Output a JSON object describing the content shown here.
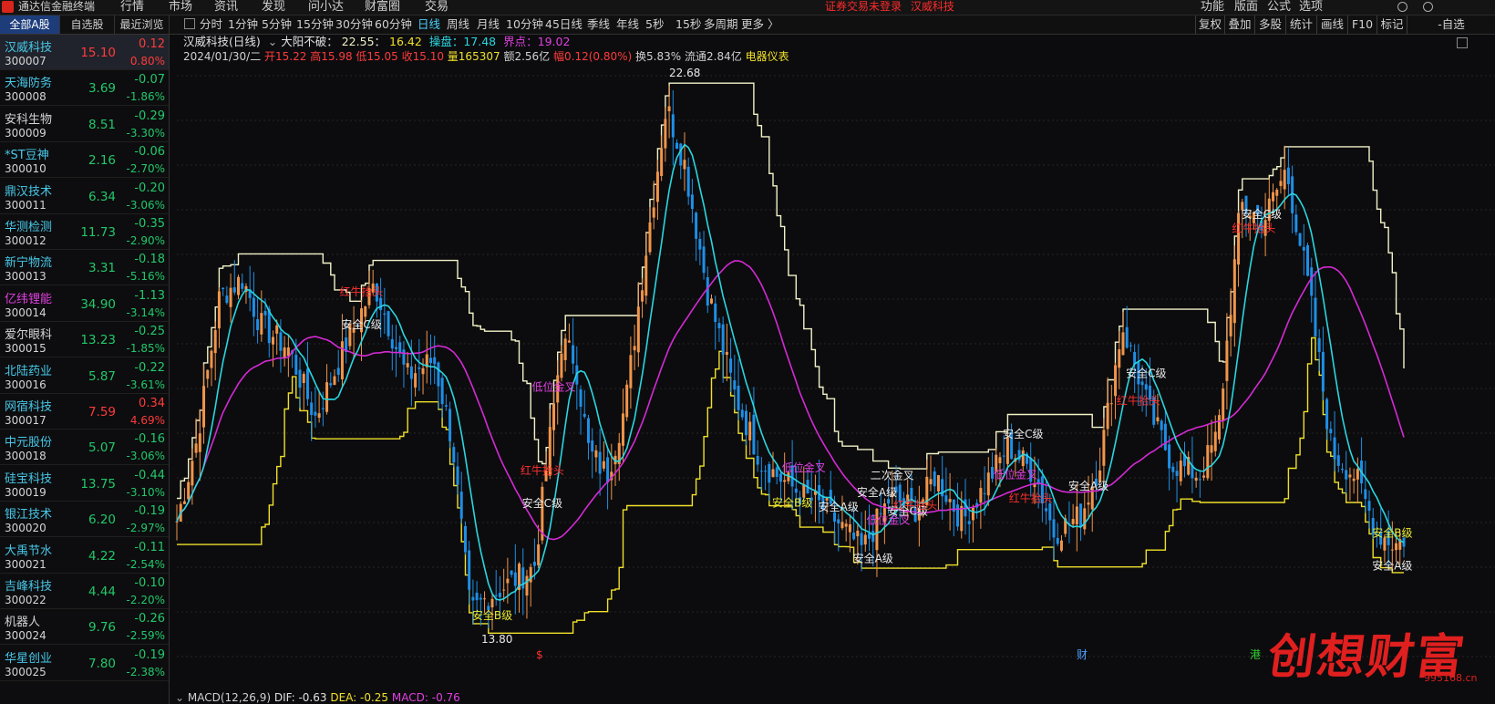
{
  "app": {
    "name": "通达信金融终端",
    "notice": "证券交易未登录",
    "current_stock": "汉威科技"
  },
  "menu": [
    "行情",
    "市场",
    "资讯",
    "发现",
    "问小达",
    "财富圈",
    "交易"
  ],
  "right_menu": [
    "功能",
    "版面",
    "公式",
    "选项"
  ],
  "list_tabs": [
    "全部A股",
    "自选股",
    "最近浏览"
  ],
  "periods": [
    "分时",
    "1分钟",
    "5分钟",
    "15分钟",
    "30分钟",
    "60分钟",
    "日线",
    "周线",
    "月线",
    "10分钟",
    "45日线",
    "季线",
    "年线",
    "5秒",
    "15秒",
    "多周期",
    "更多 〉"
  ],
  "active_period": "日线",
  "right_tools": [
    "复权",
    "叠加",
    "多股",
    "统计",
    "画线",
    "F10",
    "标记",
    "-自选"
  ],
  "stocks": [
    {
      "name": "汉威科技",
      "code": "300007",
      "price": "15.10",
      "change": "0.12",
      "pct": "0.80%",
      "dir": "up",
      "name_color": "#48c8e8"
    },
    {
      "name": "天海防务",
      "code": "300008",
      "price": "3.69",
      "change": "-0.07",
      "pct": "-1.86%",
      "dir": "dn",
      "name_color": "#48c8e8"
    },
    {
      "name": "安科生物",
      "code": "300009",
      "price": "8.51",
      "change": "-0.29",
      "pct": "-3.30%",
      "dir": "dn",
      "name_color": "#d4d4d4"
    },
    {
      "name": "*ST豆神",
      "code": "300010",
      "price": "2.16",
      "change": "-0.06",
      "pct": "-2.70%",
      "dir": "dn",
      "name_color": "#48c8e8"
    },
    {
      "name": "鼎汉技术",
      "code": "300011",
      "price": "6.34",
      "change": "-0.20",
      "pct": "-3.06%",
      "dir": "dn",
      "name_color": "#48c8e8"
    },
    {
      "name": "华测检测",
      "code": "300012",
      "price": "11.73",
      "change": "-0.35",
      "pct": "-2.90%",
      "dir": "dn",
      "name_color": "#48c8e8"
    },
    {
      "name": "新宁物流",
      "code": "300013",
      "price": "3.31",
      "change": "-0.18",
      "pct": "-5.16%",
      "dir": "dn",
      "name_color": "#48c8e8"
    },
    {
      "name": "亿纬锂能",
      "code": "300014",
      "price": "34.90",
      "change": "-1.13",
      "pct": "-3.14%",
      "dir": "dn",
      "name_color": "#e040e0"
    },
    {
      "name": "爱尔眼科",
      "code": "300015",
      "price": "13.23",
      "change": "-0.25",
      "pct": "-1.85%",
      "dir": "dn",
      "name_color": "#d4d4d4"
    },
    {
      "name": "北陆药业",
      "code": "300016",
      "price": "5.87",
      "change": "-0.22",
      "pct": "-3.61%",
      "dir": "dn",
      "name_color": "#48c8e8"
    },
    {
      "name": "网宿科技",
      "code": "300017",
      "price": "7.59",
      "change": "0.34",
      "pct": "4.69%",
      "dir": "up",
      "name_color": "#48c8e8"
    },
    {
      "name": "中元股份",
      "code": "300018",
      "price": "5.07",
      "change": "-0.16",
      "pct": "-3.06%",
      "dir": "dn",
      "name_color": "#48c8e8"
    },
    {
      "name": "硅宝科技",
      "code": "300019",
      "price": "13.75",
      "change": "-0.44",
      "pct": "-3.10%",
      "dir": "dn",
      "name_color": "#48c8e8"
    },
    {
      "name": "银江技术",
      "code": "300020",
      "price": "6.20",
      "change": "-0.19",
      "pct": "-2.97%",
      "dir": "dn",
      "name_color": "#48c8e8"
    },
    {
      "name": "大禹节水",
      "code": "300021",
      "price": "4.22",
      "change": "-0.11",
      "pct": "-2.54%",
      "dir": "dn",
      "name_color": "#48c8e8"
    },
    {
      "name": "吉峰科技",
      "code": "300022",
      "price": "4.44",
      "change": "-0.10",
      "pct": "-2.20%",
      "dir": "dn",
      "name_color": "#48c8e8"
    },
    {
      "name": "机器人",
      "code": "300024",
      "price": "9.76",
      "change": "-0.26",
      "pct": "-2.59%",
      "dir": "dn",
      "name_color": "#d4d4d4"
    },
    {
      "name": "华星创业",
      "code": "300025",
      "price": "7.80",
      "change": "-0.19",
      "pct": "-2.38%",
      "dir": "dn",
      "name_color": "#48c8e8"
    }
  ],
  "header": {
    "title": "汉威科技(日线)",
    "ind_name": "大阳不破",
    "ind_v1": "22.55",
    "ind_v2": "16.42",
    "pan_label": "操盘",
    "pan_val": "17.48",
    "jie_label": "界点",
    "jie_val": "19.02",
    "date": "2024/01/30/二",
    "open": "开15.22",
    "high": "高15.98",
    "low": "低15.05",
    "close": "收15.10",
    "vol": "量165307",
    "amt": "额2.56亿",
    "range": "幅0.12(0.80%)",
    "turnover": "换5.83%",
    "float": "流通2.84亿",
    "sector": "电器仪表"
  },
  "macd": {
    "label": "MACD(12,26,9)",
    "dif": "DIF: -0.63",
    "dea": "DEA: -0.25",
    "macd": "MACD: -0.76"
  },
  "watermark": {
    "text": "创想财富",
    "site": "995168.cn"
  },
  "colors": {
    "up": "#ff3b3b",
    "down": "#22c86a",
    "candle_up": "#f0954a",
    "candle_down": "#1e8fe6",
    "ma_fast": "#2ad6e0",
    "ma_slow": "#d42ad4",
    "upper": "#f2f2c8",
    "lower": "#f0e02a"
  },
  "chart_data": {
    "type": "candlestick",
    "peak_label": "22.68",
    "low_label": "13.80",
    "annotations": [
      {
        "text": "红牛抬头",
        "color": "#ff3030",
        "idx": 48
      },
      {
        "text": "安全C级",
        "color": "#e8e8e8",
        "idx": 48
      },
      {
        "text": "红牛抬头",
        "color": "#ff3030",
        "idx": 95
      },
      {
        "text": "安全C级",
        "color": "#e8e8e8",
        "idx": 95
      },
      {
        "text": "低位金叉",
        "color": "#e040e0",
        "idx": 98
      },
      {
        "text": "安全B级",
        "color": "#e8e830",
        "idx": 82
      },
      {
        "text": "低位金叉",
        "color": "#e040e0",
        "idx": 163
      },
      {
        "text": "安全B级",
        "color": "#e8e830",
        "idx": 160
      },
      {
        "text": "安全A级",
        "color": "#e8e8e8",
        "idx": 172
      },
      {
        "text": "安全A级",
        "color": "#e8e8e8",
        "idx": 181
      },
      {
        "text": "安全A级",
        "color": "#e8e8e8",
        "idx": 182
      },
      {
        "text": "低位金叉",
        "color": "#e040e0",
        "idx": 185
      },
      {
        "text": "二次金叉",
        "color": "#e8e8e8",
        "idx": 186
      },
      {
        "text": "安全C级",
        "color": "#e8e8e8",
        "idx": 190
      },
      {
        "text": "红牛抬头",
        "color": "#ff3030",
        "idx": 192
      },
      {
        "text": "低位金叉",
        "color": "#e040e0",
        "idx": 218
      },
      {
        "text": "安全C级",
        "color": "#e8e8e8",
        "idx": 220
      },
      {
        "text": "红牛抬头",
        "color": "#ff3030",
        "idx": 222
      },
      {
        "text": "安全A级",
        "color": "#e8e8e8",
        "idx": 237
      },
      {
        "text": "红牛抬头",
        "color": "#ff3030",
        "idx": 250
      },
      {
        "text": "安全C级",
        "color": "#e8e8e8",
        "idx": 252
      },
      {
        "text": "红牛抬头",
        "color": "#ff3030",
        "idx": 280
      },
      {
        "text": "安全C级",
        "color": "#e8e8e8",
        "idx": 282
      },
      {
        "text": "安全A级",
        "color": "#e8e8e8",
        "idx": 316
      },
      {
        "text": "安全B级",
        "color": "#e8e830",
        "idx": 316
      }
    ]
  }
}
